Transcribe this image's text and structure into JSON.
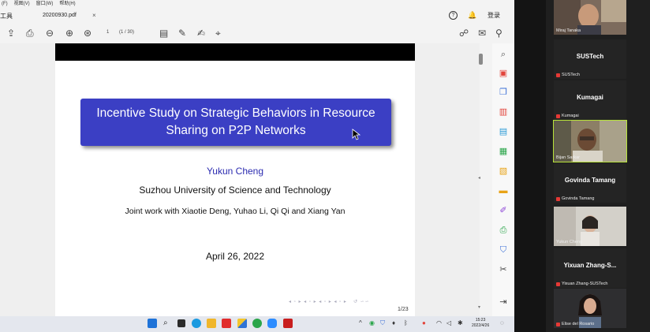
{
  "reader": {
    "menus": [
      "(F)",
      "视图(V)",
      "窗口(W)",
      "帮助(H)"
    ],
    "tools_label": "工具",
    "tab_title": "20200930.pdf",
    "tab_close": "×",
    "login_label": "登录",
    "page_indicator": "1",
    "page_total": "(1 / 30)",
    "help_glyph": "?"
  },
  "slide": {
    "title_line1": "Incentive Study on Strategic Behaviors in Resource",
    "title_line2": "Sharing on P2P Networks",
    "author": "Yukun Cheng",
    "affiliation": "Suzhou University of Science and Technology",
    "joint": "Joint work with Xiaotie Deng, Yuhao Li, Qi Qi and Xiang Yan",
    "date": "April 26, 2022",
    "slide_number": "1/23"
  },
  "taskbar": {
    "time": "15:23",
    "date": "2022/4/26"
  },
  "participants": [
    {
      "name": "Miraj Tanaka",
      "label": "Miraj Tanaka",
      "video": true,
      "active": false,
      "muted": false
    },
    {
      "name": "SUSTech",
      "label": "SUSTech",
      "video": false,
      "active": false,
      "muted": true
    },
    {
      "name": "Kumagai",
      "label": "Kumagai",
      "video": false,
      "active": false,
      "muted": true
    },
    {
      "name": "Bijan Sarkar",
      "label": "Bijan Sarkar",
      "video": true,
      "active": true,
      "muted": false
    },
    {
      "name": "Govinda Tamang",
      "label": "Govinda Tamang",
      "video": false,
      "active": false,
      "muted": true
    },
    {
      "name": "Yukun Cheng",
      "label": "Yukun Cheng",
      "video": true,
      "active": false,
      "muted": false
    },
    {
      "name": "Yixuan Zhang-S...",
      "label": "Yixuan Zhang-SUSTech",
      "video": false,
      "active": false,
      "muted": true
    },
    {
      "name": "Elise del Rosario",
      "label": "Elise del Rosario",
      "video": true,
      "active": false,
      "muted": true
    }
  ],
  "colors": {
    "title_box": "#3b3fc4",
    "author_blue": "#2b2bb0",
    "active_speaker": "#b7e23a",
    "mute_red": "#e53935"
  }
}
